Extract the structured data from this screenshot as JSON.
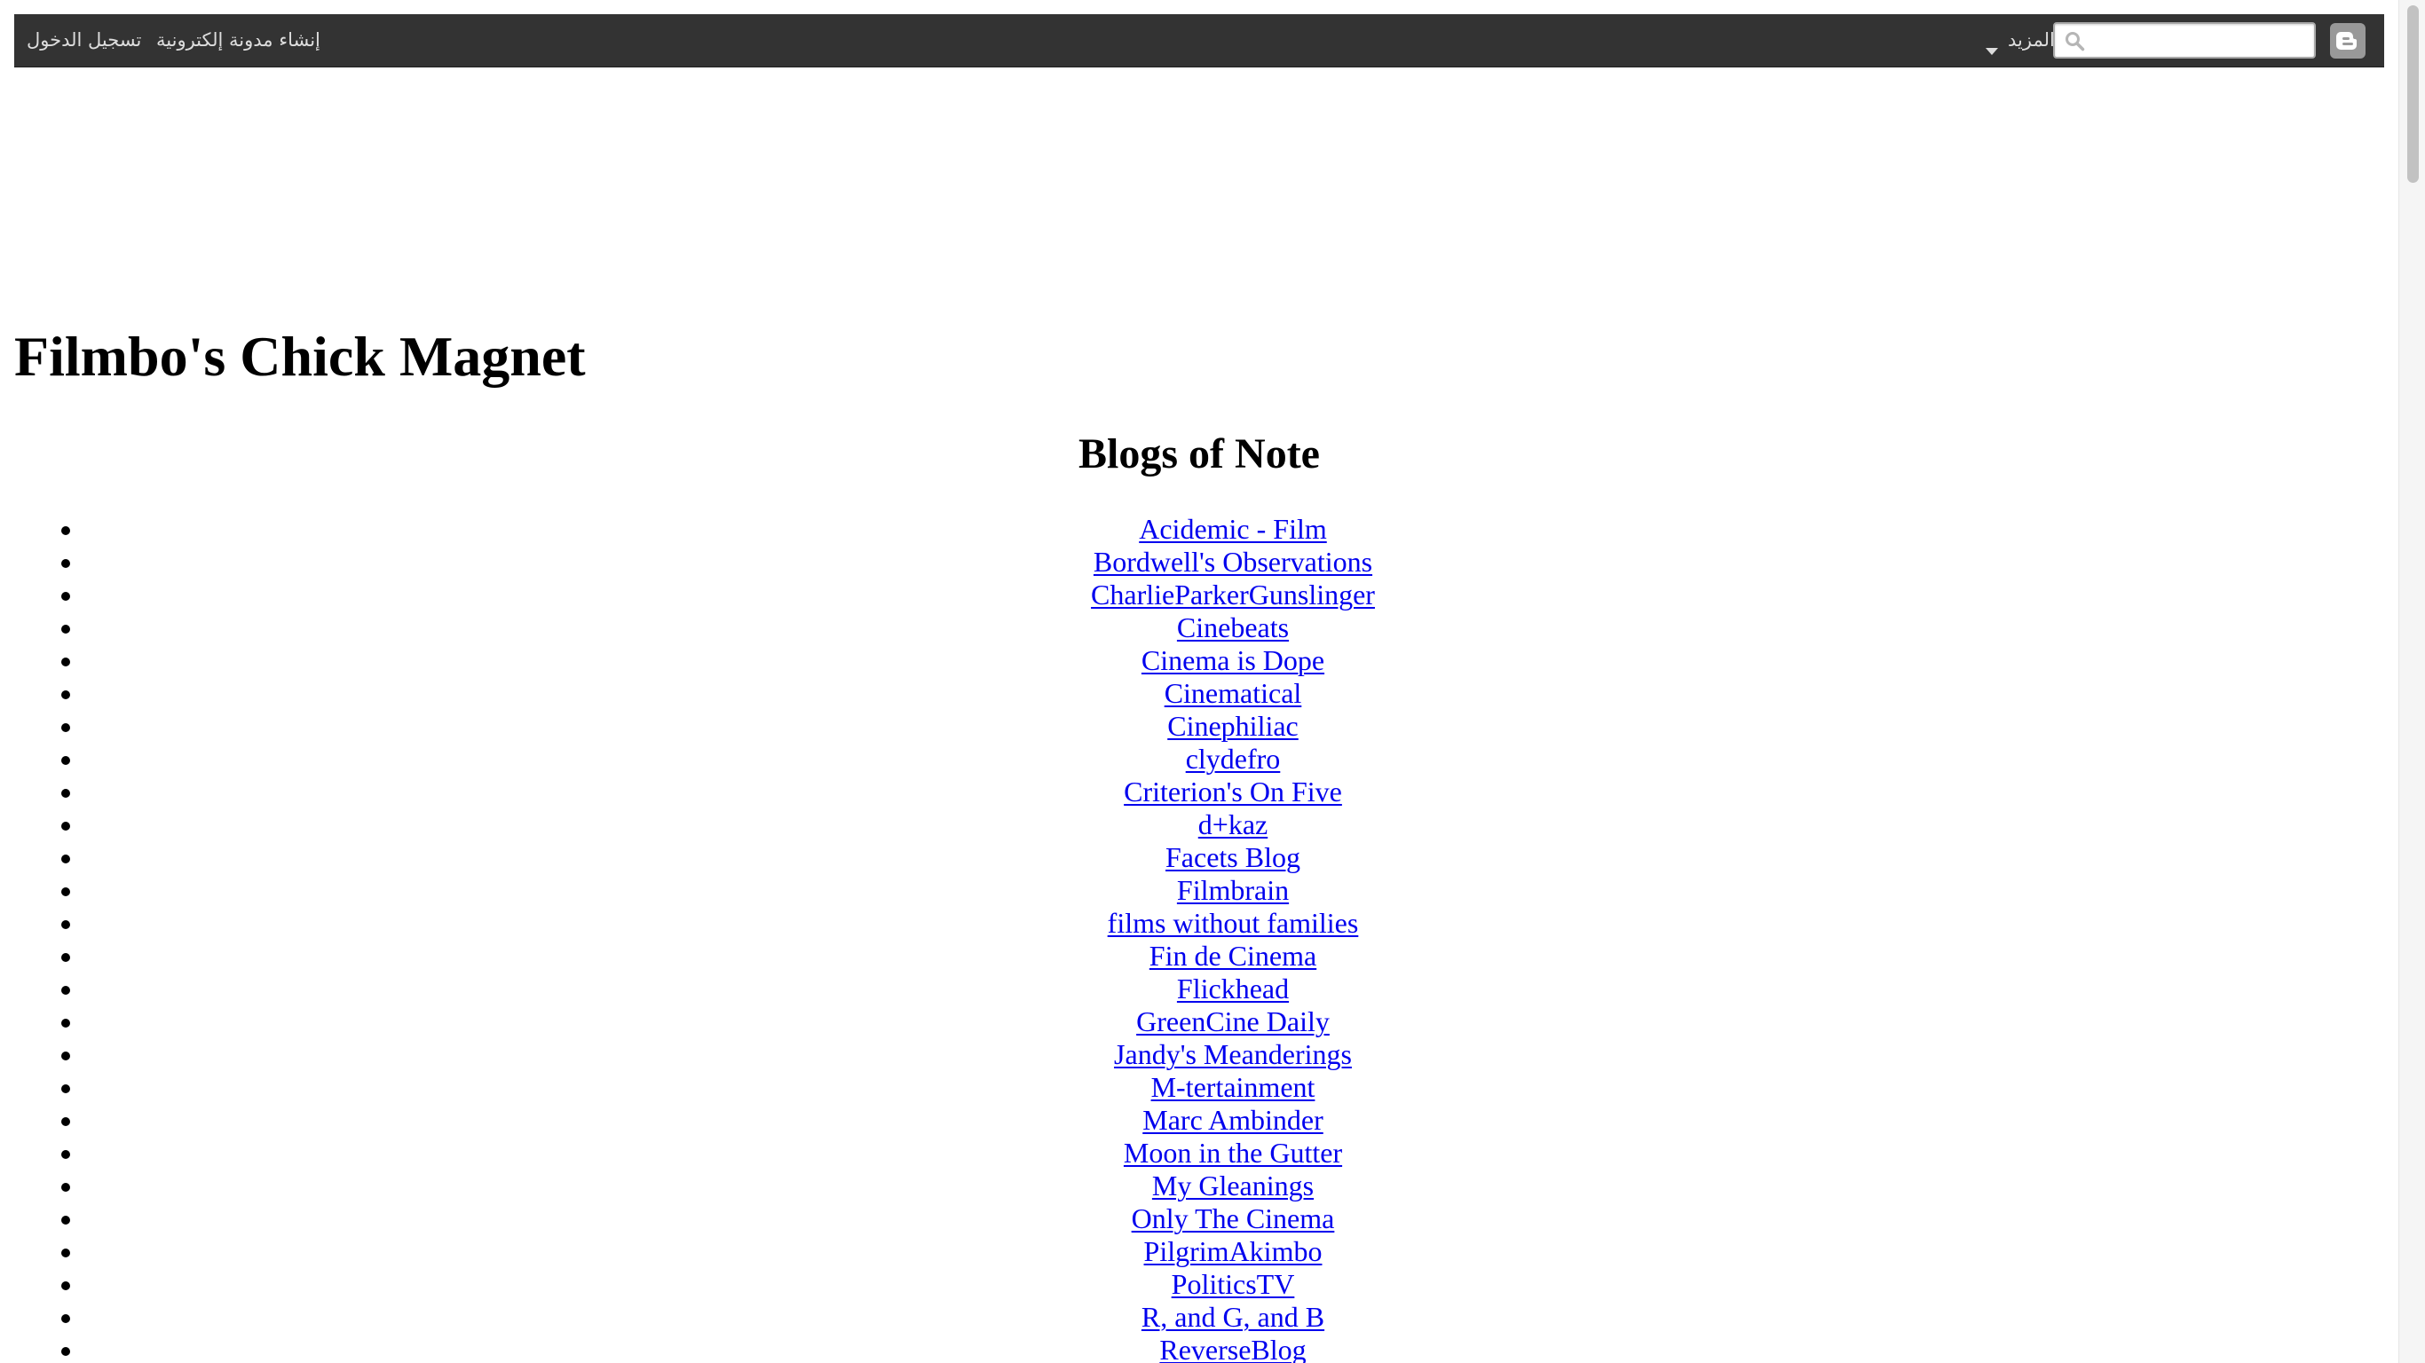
{
  "navbar": {
    "sign_in": "تسجيل الدخول",
    "create_blog": "إنشاء مدونة إلكترونية",
    "more": "المزيد",
    "search_value": "",
    "logo_icon": "blogger-icon",
    "search_icon": "search-icon",
    "background_color": "#333333"
  },
  "blog": {
    "title": "Filmbo's Chick Magnet"
  },
  "section": {
    "heading": "Blogs of Note"
  },
  "links": [
    "Acidemic - Film",
    "Bordwell's Observations",
    "CharlieParkerGunslinger",
    "Cinebeats",
    "Cinema is Dope",
    "Cinematical",
    "Cinephiliac",
    "clydefro",
    "Criterion's On Five",
    "d+kaz",
    "Facets Blog",
    "Filmbrain",
    "films without families",
    "Fin de Cinema",
    "Flickhead",
    "GreenCine Daily",
    "Jandy's Meanderings",
    "M-tertainment",
    "Marc Ambinder",
    "Moon in the Gutter",
    "My Gleanings",
    "Only The Cinema",
    "PilgrimAkimbo",
    "PoliticsTV",
    "R, and G, and B",
    "ReverseBlog"
  ],
  "colors": {
    "link": "#0000ee",
    "text": "#000000"
  }
}
